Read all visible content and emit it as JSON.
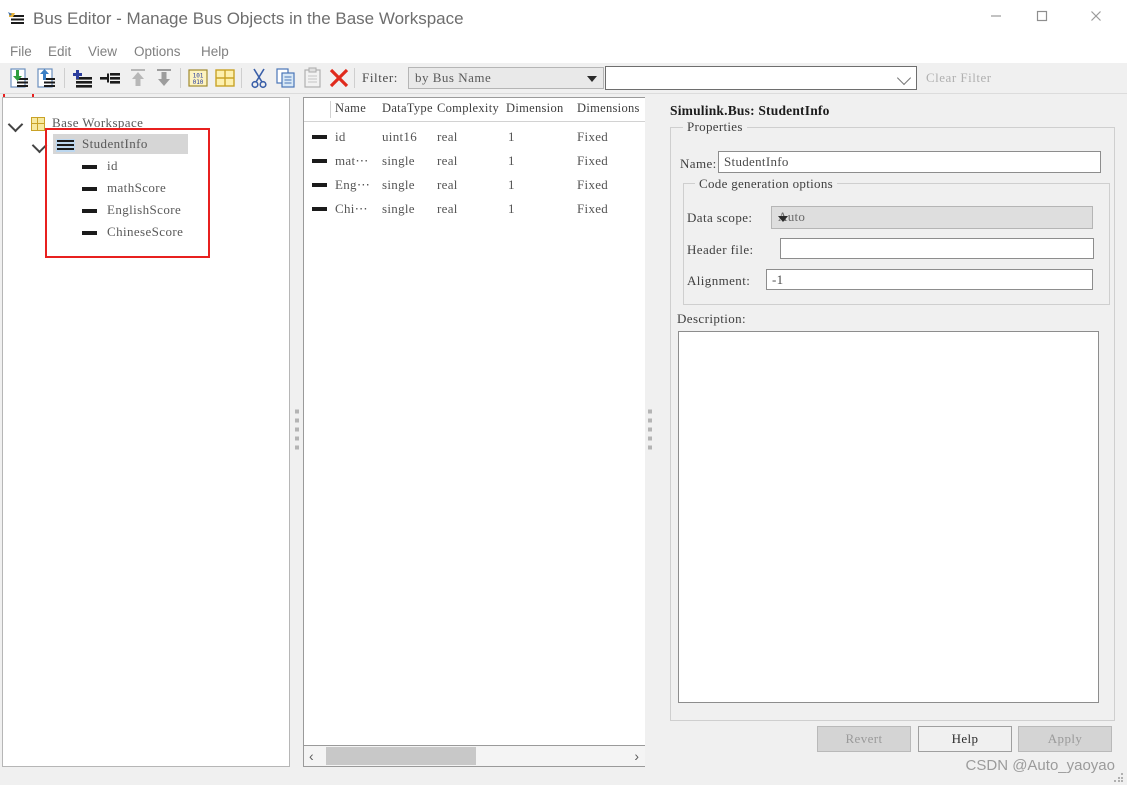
{
  "window": {
    "title": "Bus Editor - Manage Bus Objects in the Base Workspace",
    "app_icon": "bus-editor-icon",
    "minimize": "—",
    "maximize": "□",
    "close": "✕"
  },
  "menubar": {
    "items": [
      {
        "label": "File",
        "highlighted": true
      },
      {
        "label": "Edit",
        "highlighted": false
      },
      {
        "label": "View",
        "highlighted": false
      },
      {
        "label": "Options",
        "highlighted": false
      },
      {
        "label": "Help",
        "highlighted": false
      }
    ]
  },
  "toolbar": {
    "buttons": [
      {
        "name": "import-from-file-icon",
        "title": "Import"
      },
      {
        "name": "export-to-file-icon",
        "title": "Export"
      },
      {
        "name": "add-bus-icon",
        "title": "Add Bus"
      },
      {
        "name": "add-bus-element-icon",
        "title": "Add Bus Element"
      },
      {
        "name": "move-up-icon",
        "title": "Move Up"
      },
      {
        "name": "move-down-icon",
        "title": "Move Down"
      },
      {
        "name": "binary-data-icon",
        "title": "Data"
      },
      {
        "name": "grid-icon",
        "title": "Grid"
      },
      {
        "name": "cut-icon",
        "title": "Cut"
      },
      {
        "name": "copy-icon",
        "title": "Copy"
      },
      {
        "name": "paste-icon",
        "title": "Paste"
      },
      {
        "name": "delete-icon",
        "title": "Delete"
      }
    ],
    "filter_label": "Filter:",
    "filter_mode": "by Bus Name",
    "filter_text": "",
    "filter_placeholder": "",
    "clear_filter_label": "Clear Filter"
  },
  "tree": {
    "root": {
      "label": "Base Workspace",
      "icon": "grid-workspace-icon",
      "expanded": true
    },
    "bus": {
      "label": "StudentInfo",
      "icon": "bus-object-icon",
      "expanded": true,
      "selected": true
    },
    "elements": [
      {
        "label": "id",
        "icon": "bus-element-icon"
      },
      {
        "label": "mathScore",
        "icon": "bus-element-icon"
      },
      {
        "label": "EnglishScore",
        "icon": "bus-element-icon"
      },
      {
        "label": "ChineseScore",
        "icon": "bus-element-icon"
      }
    ],
    "highlight_color": "#e8201f"
  },
  "table": {
    "columns": [
      "Name",
      "DataType",
      "Complexity",
      "Dimensions",
      "Dimensions"
    ],
    "columns_display": [
      "Name",
      "DataType",
      "Complexity",
      "Dimension",
      "Dimensions"
    ],
    "rows": [
      {
        "icon": "bus-element-icon",
        "name": "id",
        "name_display": "id",
        "datatype": "uint16",
        "complexity": "real",
        "dimensions": "1",
        "dimensions_mode": "Fixed"
      },
      {
        "icon": "bus-element-icon",
        "name": "mathScore",
        "name_display": "mat⋯",
        "datatype": "single",
        "complexity": "real",
        "dimensions": "1",
        "dimensions_mode": "Fixed"
      },
      {
        "icon": "bus-element-icon",
        "name": "EnglishScore",
        "name_display": "Eng⋯",
        "datatype": "single",
        "complexity": "real",
        "dimensions": "1",
        "dimensions_mode": "Fixed"
      },
      {
        "icon": "bus-element-icon",
        "name": "ChineseScore",
        "name_display": "Chi⋯",
        "datatype": "single",
        "complexity": "real",
        "dimensions": "1",
        "dimensions_mode": "Fixed"
      }
    ],
    "scroll_left_arrow": "‹",
    "scroll_right_arrow": "›"
  },
  "properties": {
    "title": "Simulink.Bus: StudentInfo",
    "group_label": "Properties",
    "name_label": "Name:",
    "name_value": "StudentInfo",
    "codegen": {
      "group_label": "Code generation options",
      "data_scope_label": "Data scope:",
      "data_scope_value": "Auto",
      "header_file_label": "Header file:",
      "header_file_value": "",
      "alignment_label": "Alignment:",
      "alignment_value": "-1"
    },
    "description_label": "Description:",
    "description_value": "",
    "buttons": [
      {
        "label": "Revert",
        "enabled": false
      },
      {
        "label": "Help",
        "enabled": true
      },
      {
        "label": "Apply",
        "enabled": false
      }
    ]
  },
  "watermark": "CSDN @Auto_yaoyao"
}
